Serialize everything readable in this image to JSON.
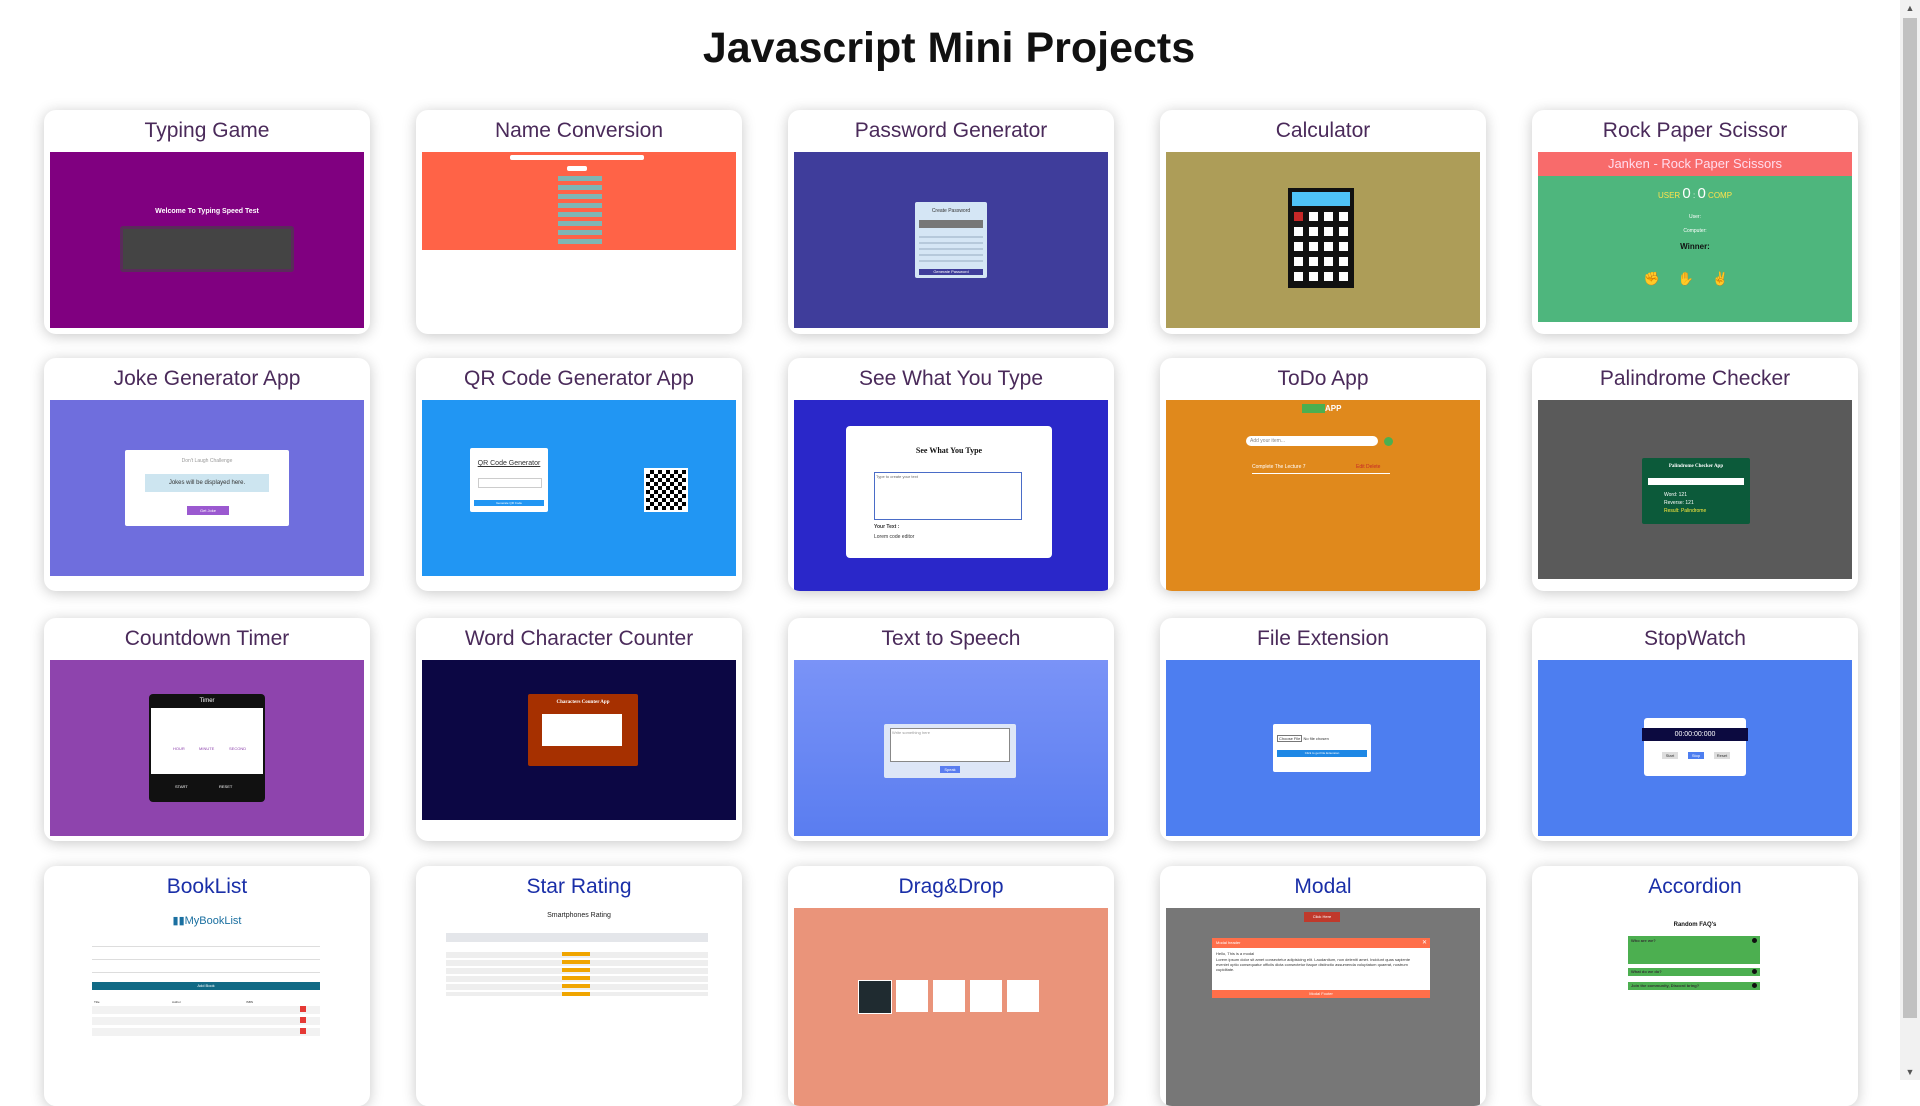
{
  "page": {
    "title": "Javascript Mini Projects"
  },
  "projects": [
    {
      "title": "Typing Game",
      "preview": {
        "heading": "Welcome To Typing Speed Test"
      }
    },
    {
      "title": "Name Conversion"
    },
    {
      "title": "Password Generator",
      "preview": {
        "heading": "Create Password",
        "button": "Generate Password"
      }
    },
    {
      "title": "Calculator"
    },
    {
      "title": "Rock Paper Scissor",
      "preview": {
        "heading": "Janken - Rock Paper Scissors",
        "user": "USER",
        "comp": "COMP",
        "score_user": "0",
        "score_comp": "0",
        "user_label": "User:",
        "computer_label": "Computer:",
        "winner_label": "Winner:"
      }
    },
    {
      "title": "Joke Generator App",
      "preview": {
        "heading": "Don't Laugh Challenge",
        "text": "Jokes will be displayed here.",
        "button": "Get Joke"
      }
    },
    {
      "title": "QR Code Generator App",
      "preview": {
        "heading": "QR Code Generator",
        "button": "Generate QR Code"
      }
    },
    {
      "title": "See What You Type",
      "preview": {
        "heading": "See What You Type",
        "placeholder": "Type to create your text",
        "result_label": "Your Text :",
        "result": "Lorem code editor"
      }
    },
    {
      "title": "ToDo App",
      "preview": {
        "heading": "APP",
        "placeholder": "Add your item...",
        "item": "Complete The Lecture 7",
        "actions": "Edit Delete"
      }
    },
    {
      "title": "Palindrome Checker",
      "preview": {
        "heading": "Palindrome Checker App",
        "word": "Word: 121",
        "reverse": "Reverse: 121",
        "result": "Result: Palindrome"
      }
    },
    {
      "title": "Countdown Timer",
      "preview": {
        "heading": "Timer",
        "hour": "HOUR",
        "minute": "MINUTE",
        "second": "SECOND",
        "start": "START",
        "reset": "RESET"
      }
    },
    {
      "title": "Word Character Counter",
      "preview": {
        "heading": "Characters Counter App"
      }
    },
    {
      "title": "Text to Speech",
      "preview": {
        "placeholder": "Write something here",
        "button": "Speak"
      }
    },
    {
      "title": "File Extension",
      "preview": {
        "button": "Choose File",
        "file": "No file chosen",
        "action": "Click to get File Extension"
      }
    },
    {
      "title": "StopWatch",
      "preview": {
        "time": "00:00:00:000",
        "start": "Start",
        "stop": "Stop",
        "reset": "Reset"
      }
    },
    {
      "title": "BookList",
      "preview": {
        "heading": "MyBookList",
        "button": "Add Book",
        "headers": [
          "Title",
          "Author",
          "ISBN"
        ]
      }
    },
    {
      "title": "Star Rating",
      "preview": {
        "heading": "Smartphones Rating"
      }
    },
    {
      "title": "Drag&Drop"
    },
    {
      "title": "Modal",
      "preview": {
        "button": "Click Here",
        "header": "Modal header",
        "text": "Hello, This is a modal",
        "body": "Lorem ipsum dolor sit amet consectetur adipisicing elit. Laudantium, non deleniti amet. Incidunt quas sapiente eveniet optio consequatur officiis dicta consectetur itaque distinctio assumenda voluptatum quaerat, nostrum cupiditate.",
        "footer": "Modal Footer"
      }
    },
    {
      "title": "Accordion",
      "preview": {
        "heading": "Random FAQ's",
        "q1": "Who are we?",
        "q2": "What do we do?",
        "q3": "Join the community, Discord bring?"
      }
    }
  ],
  "colors": {
    "typing": "#800080",
    "name": "#ff6347",
    "password": "#3f3d9b",
    "calculator": "#ad9d58",
    "rps": "#4eb67d",
    "joke": "#6f6edd",
    "qr": "#2196f3",
    "seewhat": "#2a27c9",
    "todo": "#e0891c",
    "palindrome": "#5a5a5a",
    "countdown": "#8e44ad",
    "wordcount": "#0c0744",
    "tts": "#6b8cf5",
    "file": "#4d7ef0",
    "stopwatch": "#4d7ef0",
    "drag": "#ea947a",
    "modal": "#777777"
  }
}
